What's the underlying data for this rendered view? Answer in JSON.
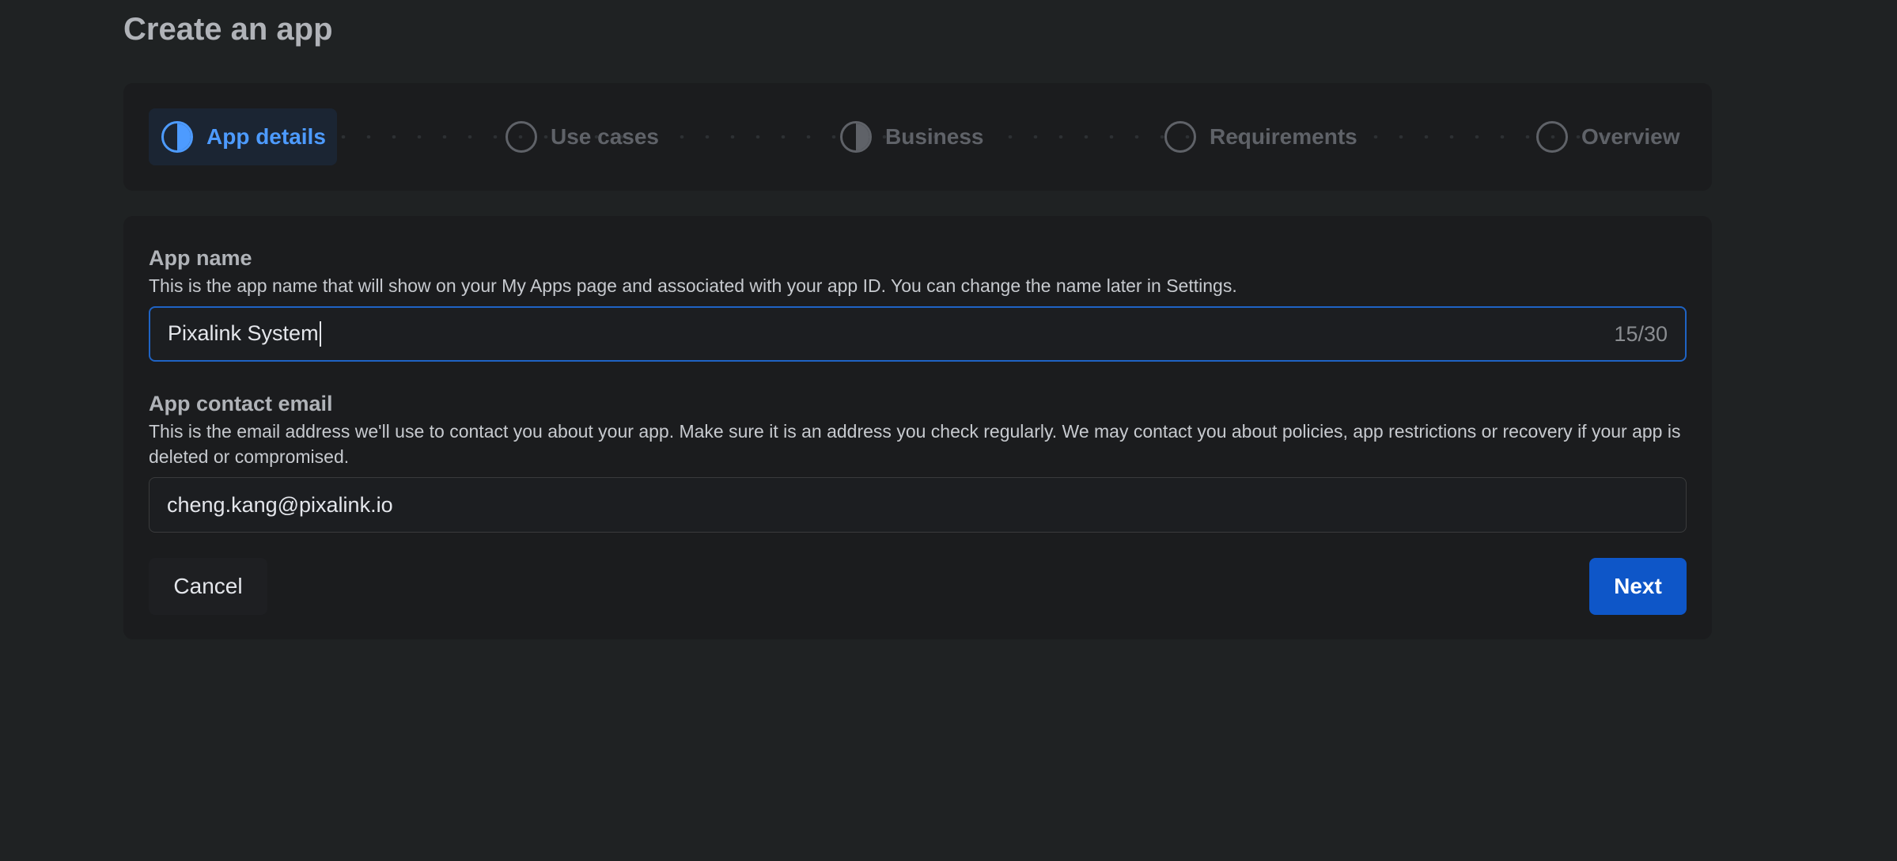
{
  "page": {
    "title": "Create an app"
  },
  "stepper": {
    "steps": [
      {
        "label": "App details",
        "state": "active",
        "icon": "half-filled-circle-icon"
      },
      {
        "label": "Use cases",
        "state": "pending",
        "icon": "empty-circle-icon"
      },
      {
        "label": "Business",
        "state": "partial",
        "icon": "half-filled-circle-icon"
      },
      {
        "label": "Requirements",
        "state": "pending",
        "icon": "empty-circle-icon"
      },
      {
        "label": "Overview",
        "state": "pending",
        "icon": "empty-circle-icon"
      }
    ]
  },
  "form": {
    "app_name": {
      "label": "App name",
      "help": "This is the app name that will show on your My Apps page and associated with your app ID. You can change the name later in Settings.",
      "value": "Pixalink System",
      "char_count": "15/30"
    },
    "contact_email": {
      "label": "App contact email",
      "help": "This is the email address we'll use to contact you about your app. Make sure it is an address you check regularly. We may contact you about policies, app restrictions or recovery if your app is deleted or compromised.",
      "value": "cheng.kang@pixalink.io"
    },
    "cancel_label": "Cancel",
    "next_label": "Next"
  },
  "colors": {
    "background": "#1f2223",
    "card": "#1b1c1e",
    "accent": "#4d9bff",
    "primary_button": "#0e56c8",
    "focus_border": "#1f63c4"
  }
}
